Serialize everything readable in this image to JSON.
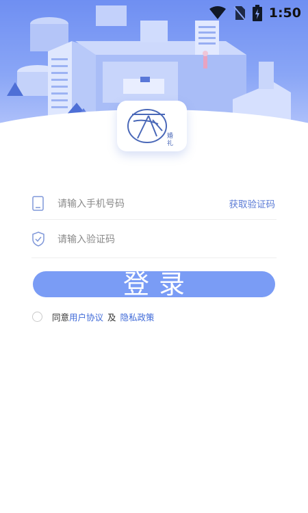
{
  "status_bar": {
    "time": "1:50",
    "icons": [
      "wifi-icon",
      "no-sim-icon",
      "battery-charging-icon"
    ]
  },
  "logo": {
    "subtitle_top": "婚",
    "subtitle_bottom": "礼"
  },
  "form": {
    "phone": {
      "placeholder": "请输入手机号码",
      "value": "",
      "icon": "phone-icon"
    },
    "get_code_label": "获取验证码",
    "code": {
      "placeholder": "请输入验证码",
      "value": "",
      "icon": "shield-check-icon"
    }
  },
  "login_button_label": "登录",
  "agreement": {
    "prefix": "同意",
    "user_agreement": "用户协议",
    "and": "及",
    "privacy_policy": "隐私政策"
  },
  "colors": {
    "accent": "#7a9cf5",
    "link": "#3f6ad8",
    "hero_top": "#6f8ff2"
  }
}
